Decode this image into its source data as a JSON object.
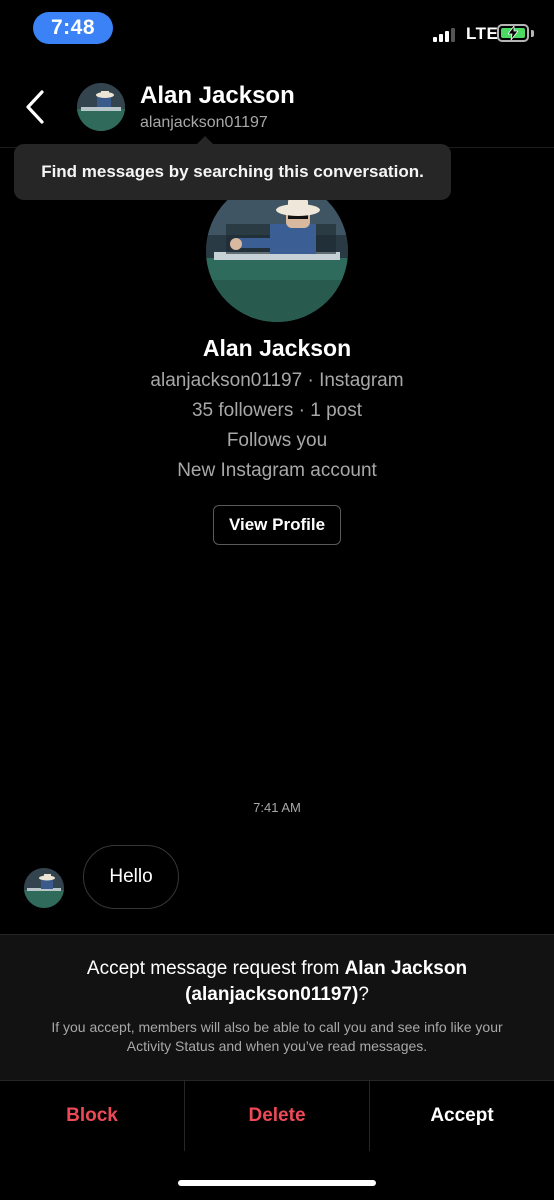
{
  "status_bar": {
    "time": "7:48",
    "network": "LTE"
  },
  "header": {
    "name": "Alan Jackson",
    "username": "alanjackson01197"
  },
  "tooltip": {
    "text": "Find messages by searching this conversation."
  },
  "profile": {
    "name": "Alan Jackson",
    "handle_line": "alanjackson01197 · Instagram",
    "stats_line": "35 followers · 1 post",
    "follows_line": "Follows you",
    "account_line": "New Instagram account",
    "view_profile_label": "View Profile"
  },
  "conversation": {
    "timestamp": "7:41 AM",
    "messages": [
      {
        "text": "Hello"
      }
    ]
  },
  "request": {
    "title_prefix": "Accept message request from ",
    "title_name": "Alan Jackson",
    "title_username": "(alanjackson01197)",
    "title_suffix": "?",
    "description": "If you accept, members will also be able to call you and see info like your Activity Status and when you’ve read messages."
  },
  "actions": {
    "block": "Block",
    "delete": "Delete",
    "accept": "Accept"
  },
  "colors": {
    "accent_blue": "#3a82f6",
    "danger_red": "#ed4956",
    "battery_green": "#4cd964",
    "background": "#000000"
  }
}
